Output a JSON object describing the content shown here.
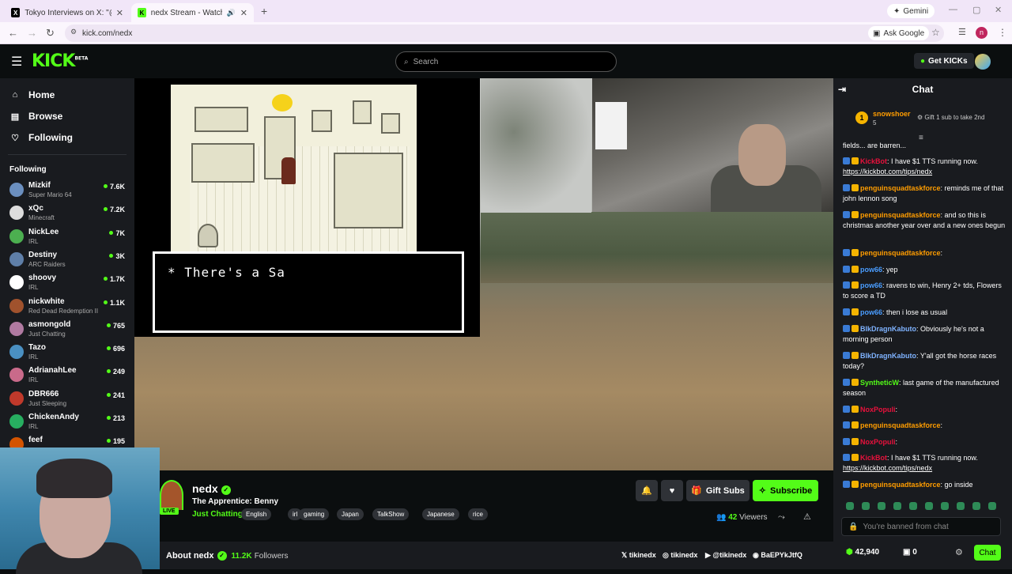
{
  "browser": {
    "tabs": [
      {
        "label": "Tokyo Interviews on X: \"@calle",
        "icon": "x-logo-icon"
      },
      {
        "label": "nedx Stream - Watch Live o",
        "icon": "kick-logo-icon"
      }
    ],
    "gemini": "Gemini",
    "url": "kick.com/nedx",
    "ask_google": "Ask Google",
    "profile_initial": "n"
  },
  "header": {
    "logo": "KICK",
    "logo_sup": "BETA",
    "search_placeholder": "Search",
    "get_kicks": "Get KICKs"
  },
  "sidebar": {
    "nav": [
      {
        "label": "Home",
        "icon": "home-icon"
      },
      {
        "label": "Browse",
        "icon": "browse-icon"
      },
      {
        "label": "Following",
        "icon": "heart-icon"
      }
    ],
    "following_title": "Following",
    "channels": [
      {
        "name": "Mizkif",
        "category": "Super Mario 64",
        "viewers": "7.6K",
        "color": "#6b8fbf"
      },
      {
        "name": "xQc",
        "category": "Minecraft",
        "viewers": "7.2K",
        "color": "#dddddd"
      },
      {
        "name": "NickLee",
        "category": "IRL",
        "viewers": "7K",
        "color": "#4caf50"
      },
      {
        "name": "Destiny",
        "category": "ARC Raiders",
        "viewers": "3K",
        "color": "#5f7fa8"
      },
      {
        "name": "shoovy",
        "category": "IRL",
        "viewers": "1.7K",
        "color": "#ffffff"
      },
      {
        "name": "nickwhite",
        "category": "Red Dead Redemption II",
        "viewers": "1.1K",
        "color": "#a0522d"
      },
      {
        "name": "asmongold",
        "category": "Just Chatting",
        "viewers": "765",
        "color": "#b07aa1"
      },
      {
        "name": "Tazo",
        "category": "IRL",
        "viewers": "696",
        "color": "#4a90c2"
      },
      {
        "name": "AdrianahLee",
        "category": "IRL",
        "viewers": "249",
        "color": "#c96a8a"
      },
      {
        "name": "DBR666",
        "category": "Just Sleeping",
        "viewers": "241",
        "color": "#c0392b"
      },
      {
        "name": "ChickenAndy",
        "category": "IRL",
        "viewers": "213",
        "color": "#27ae60"
      },
      {
        "name": "feef",
        "category": "",
        "viewers": "195",
        "color": "#d35400"
      }
    ]
  },
  "player": {
    "dialog_text": "* There's a Sa"
  },
  "stream": {
    "channel": "nedx",
    "title": "The Apprentice: Benny",
    "category": "Just Chatting",
    "live": "LIVE",
    "tags": [
      "English",
      "irl",
      "gaming",
      "Japan",
      "TalkShow",
      "Japanese",
      "rice"
    ],
    "gift_subs": "Gift Subs",
    "subscribe": "Subscribe",
    "viewers_count": "42",
    "viewers_label": "Viewers",
    "about": "About nedx",
    "followers_count": "11.2K",
    "followers_label": "Followers",
    "socials": [
      "tikinedx",
      "tikinedx",
      "@tikinedx",
      "BaEPYkJtfQ"
    ]
  },
  "chat": {
    "title": "Chat",
    "pinned": {
      "user": "snowshoer",
      "rank": "5",
      "note": "Gift 1 sub to take 2nd"
    },
    "messages": [
      {
        "user": "",
        "color": "#fff",
        "text": "fields... are barren..."
      },
      {
        "user": "KickBot",
        "color": "#e9113c",
        "text": ": I have $1 TTS running now.",
        "link": "https://kickbot.com/tips/nedx"
      },
      {
        "user": "penguinsquadtaskforce",
        "color": "#ff9d00",
        "text": ": reminds me of that john lennon song"
      },
      {
        "user": "penguinsquadtaskforce",
        "color": "#ff9d00",
        "text": ": and so this is christmas another year over and a new ones begun"
      },
      {
        "user": "penguinsquadtaskforce",
        "color": "#ff9d00",
        "text": ":"
      },
      {
        "user": "pow66",
        "color": "#4a9dff",
        "text": ": yep"
      },
      {
        "user": "pow66",
        "color": "#4a9dff",
        "text": ": ravens to win, Henry 2+ tds, Flowers to score a TD"
      },
      {
        "user": "pow66",
        "color": "#4a9dff",
        "text": ": then i lose as usual"
      },
      {
        "user": "BlkDragnKabuto",
        "color": "#7fb3ff",
        "text": ": Obviously he's not a morning person"
      },
      {
        "user": "BlkDragnKabuto",
        "color": "#7fb3ff",
        "text": ": Y'all got the horse races today?"
      },
      {
        "user": "SyntheticW",
        "color": "#53fc18",
        "text": ": last game of the manufactured season"
      },
      {
        "user": "NoxPopuli",
        "color": "#e9113c",
        "text": ":"
      },
      {
        "user": "penguinsquadtaskforce",
        "color": "#ff9d00",
        "text": ":"
      },
      {
        "user": "NoxPopuli",
        "color": "#e9113c",
        "text": ":"
      },
      {
        "user": "KickBot",
        "color": "#e9113c",
        "text": ": I have $1 TTS running now.",
        "link": "https://kickbot.com/tips/nedx"
      },
      {
        "user": "penguinsquadtaskforce",
        "color": "#ff9d00",
        "text": ": go inside"
      }
    ],
    "input_placeholder": "You're banned from chat",
    "kicks": "42,940",
    "gifts": "0",
    "chat_button": "Chat"
  }
}
